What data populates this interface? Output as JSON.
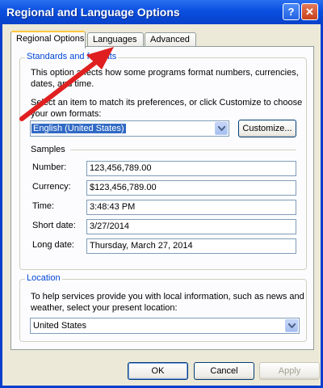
{
  "window": {
    "title": "Regional and Language Options",
    "help_glyph": "?",
    "close_glyph": "✕"
  },
  "tabs": [
    {
      "label": "Regional Options",
      "active": true
    },
    {
      "label": "Languages",
      "active": false
    },
    {
      "label": "Advanced",
      "active": false
    }
  ],
  "standards": {
    "legend": "Standards and formats",
    "description": "This option affects how some programs format numbers, currencies, dates, and time.",
    "desc_line1": "This option affects how some programs format numbers, currencies,",
    "desc_line2": "dates, and time.",
    "select_line1": "Select an item to match its preferences, or click Customize to choose",
    "select_line2": "your own formats:",
    "format_value": "English (United States)",
    "customize_label": "Customize..."
  },
  "samples": {
    "heading": "Samples",
    "rows": [
      {
        "label": "Number:",
        "value": "123,456,789.00"
      },
      {
        "label": "Currency:",
        "value": "$123,456,789.00"
      },
      {
        "label": "Time:",
        "value": "3:48:43 PM"
      },
      {
        "label": "Short date:",
        "value": "3/27/2014"
      },
      {
        "label": "Long date:",
        "value": "Thursday, March 27, 2014"
      }
    ]
  },
  "location": {
    "legend": "Location",
    "line1": "To help services provide you with local information, such as news and",
    "line2": "weather, select your present location:",
    "value": "United States"
  },
  "footer": {
    "ok_label": "OK",
    "cancel_label": "Cancel",
    "apply_label": "Apply"
  },
  "colors": {
    "annotation_arrow": "#E02020",
    "legend_text": "#0046D5",
    "titlebar": "#0A4FE0"
  }
}
